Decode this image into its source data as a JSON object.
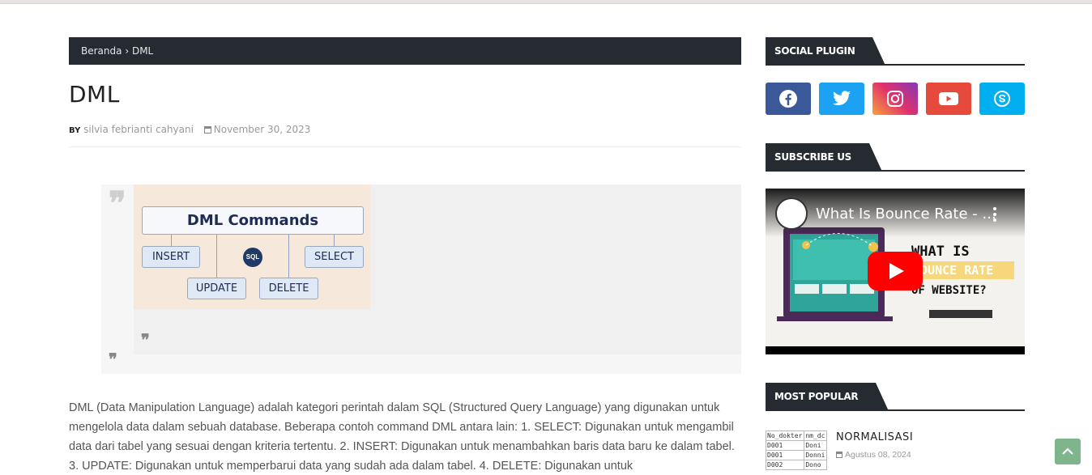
{
  "breadcrumb": {
    "home": "Beranda",
    "separator": "›",
    "current": "DML"
  },
  "post": {
    "title": "DML",
    "by_label": "BY",
    "author": "silvia febrianti cahyani",
    "date": "November 30, 2023",
    "body": "DML (Data Manipulation Language) adalah kategori perintah dalam SQL (Structured Query Language) yang digunakan untuk mengelola data dalam sebuah database. Beberapa contoh command DML antara lain: 1. SELECT: Digunakan untuk mengambil data dari tabel yang sesuai dengan kriteria tertentu. 2. INSERT: Digunakan untuk menambahkan baris data baru ke dalam tabel. 3. UPDATE: Digunakan untuk memperbarui data yang sudah ada dalam tabel. 4. DELETE: Digunakan untuk"
  },
  "diagram": {
    "heading": "DML Commands",
    "badge": "SQL",
    "commands": [
      "INSERT",
      "SELECT",
      "UPDATE",
      "DELETE"
    ]
  },
  "sidebar": {
    "social_title": "SOCIAL PLUGIN",
    "social": [
      {
        "name": "facebook",
        "icon": "facebook-icon",
        "color": "#3b5998"
      },
      {
        "name": "twitter",
        "icon": "twitter-icon",
        "color": "#1da1f2"
      },
      {
        "name": "instagram",
        "icon": "instagram-icon",
        "color": "#c13584"
      },
      {
        "name": "youtube",
        "icon": "youtube-icon",
        "color": "#e54a3c"
      },
      {
        "name": "skype",
        "icon": "skype-icon",
        "color": "#00aff0"
      }
    ],
    "subscribe_title": "SUBSCRIBE US",
    "video": {
      "title": "What Is Bounce Rate - ...",
      "thumb_line1": "WHAT IS",
      "thumb_line2": "BOUNCE RATE",
      "thumb_line3": "OF WEBSITE?"
    },
    "popular_title": "MOST POPULAR",
    "popular": [
      {
        "title": "NORMALISASI",
        "date": "Agustus 08, 2024",
        "thumb_rows": [
          [
            "No_dokter",
            "nm_dc"
          ],
          [
            "D001",
            "Doni"
          ],
          [
            "D001",
            "Donni"
          ],
          [
            "D002",
            "Dono"
          ]
        ]
      }
    ]
  }
}
